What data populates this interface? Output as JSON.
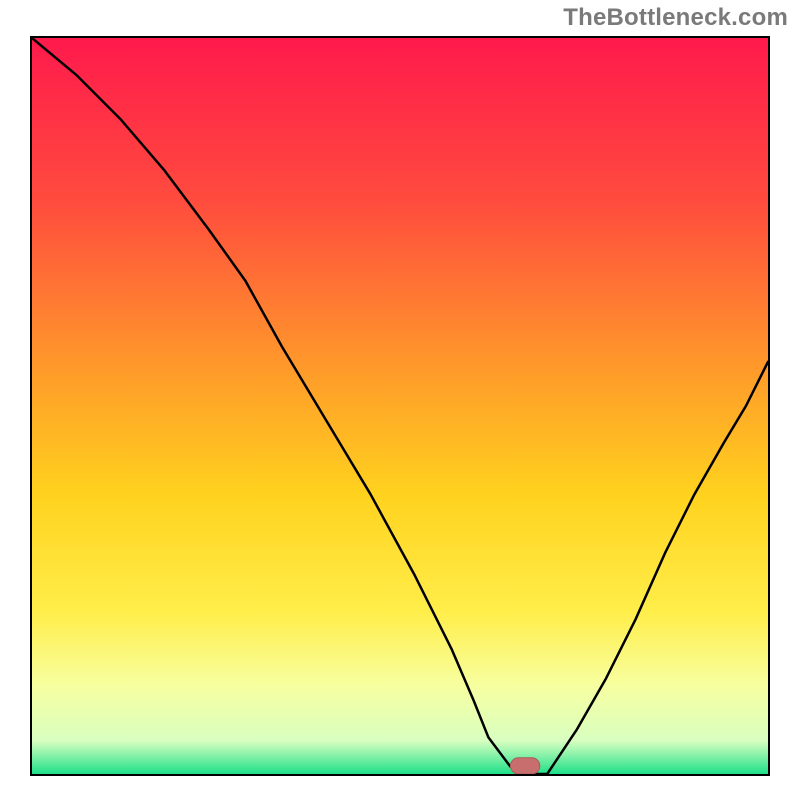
{
  "watermark": "TheBottleneck.com",
  "chart_data": {
    "type": "line",
    "title": "",
    "xlabel": "",
    "ylabel": "",
    "xlim": [
      0,
      100
    ],
    "ylim": [
      0,
      100
    ],
    "grid": false,
    "legend_position": "none",
    "background_gradient": {
      "stops": [
        {
          "offset": 0.0,
          "color": "#ff1a4c"
        },
        {
          "offset": 0.22,
          "color": "#ff4b3e"
        },
        {
          "offset": 0.45,
          "color": "#ff9a2a"
        },
        {
          "offset": 0.62,
          "color": "#ffd21e"
        },
        {
          "offset": 0.78,
          "color": "#ffee4a"
        },
        {
          "offset": 0.88,
          "color": "#f7ffa0"
        },
        {
          "offset": 0.955,
          "color": "#d8ffc0"
        },
        {
          "offset": 1.0,
          "color": "#1ee08a"
        }
      ]
    },
    "series": [
      {
        "name": "bottleneck-curve",
        "x": [
          0,
          6,
          12,
          18,
          24,
          29,
          34,
          40,
          46,
          52,
          57,
          60,
          62,
          65,
          68,
          70,
          74,
          78,
          82,
          86,
          90,
          94,
          97,
          100
        ],
        "y": [
          100,
          95,
          89,
          82,
          74,
          67,
          58,
          48,
          38,
          27,
          17,
          10,
          5,
          1,
          0,
          0,
          6,
          13,
          21,
          30,
          38,
          45,
          50,
          56
        ]
      }
    ],
    "marker": {
      "name": "optimal-point",
      "x_center": 67,
      "y_center": 0,
      "width": 4,
      "height": 2.2,
      "rx": 1.1,
      "color": "#c86e6e"
    }
  }
}
